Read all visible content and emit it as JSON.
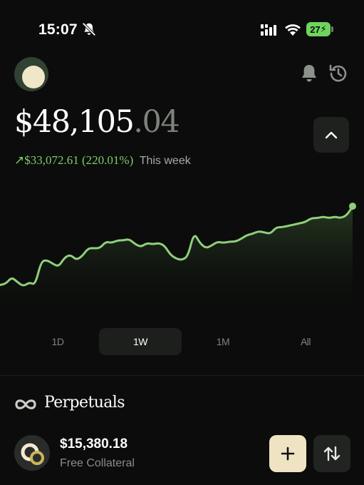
{
  "status_bar": {
    "time": "15:07",
    "battery": "27",
    "icons": [
      "bell-off-icon",
      "signal-icon",
      "wifi-icon",
      "battery-icon"
    ]
  },
  "header": {
    "icons": [
      "avatar",
      "bell-icon",
      "history-icon"
    ]
  },
  "balance": {
    "dollars": "$48,105",
    "cents": ".04"
  },
  "change": {
    "arrow": "↗",
    "amount": "$33,072.61 (220.01%)",
    "period": "This week"
  },
  "chart_data": {
    "type": "line",
    "x": [
      0,
      1,
      2,
      3,
      4,
      5,
      6,
      7,
      8,
      9,
      10,
      11,
      12,
      13,
      14,
      15,
      16,
      17,
      18,
      19,
      20,
      21,
      22,
      23,
      24,
      25,
      26,
      27,
      28,
      29,
      30,
      31,
      32,
      33,
      34,
      35,
      36,
      37,
      38,
      39,
      40,
      41,
      42,
      43,
      44,
      45,
      46,
      47,
      48,
      49,
      50,
      51,
      52,
      53,
      54,
      55,
      56,
      57,
      58,
      59,
      60
    ],
    "values": [
      22,
      23,
      28,
      24,
      21,
      24,
      22,
      40,
      41,
      38,
      36,
      43,
      45,
      41,
      44,
      50,
      50,
      50,
      55,
      54,
      56,
      56,
      57,
      53,
      51,
      54,
      53,
      54,
      52,
      45,
      42,
      41,
      44,
      62,
      54,
      50,
      52,
      55,
      54,
      55,
      55,
      57,
      60,
      61,
      63,
      62,
      61,
      66,
      66,
      67,
      68,
      69,
      70,
      73,
      73,
      74,
      73,
      74,
      73,
      75,
      82
    ],
    "ylim": [
      0,
      100
    ],
    "color": "#8fcf7c",
    "grid": false,
    "xlabel": "",
    "ylabel": ""
  },
  "range_tabs": [
    {
      "label": "1D",
      "active": false
    },
    {
      "label": "1W",
      "active": true
    },
    {
      "label": "1M",
      "active": false
    },
    {
      "label": "All",
      "active": false
    }
  ],
  "perpetuals": {
    "title": "Perpetuals",
    "icon": "infinity-icon",
    "collateral_amount": "$15,380.18",
    "collateral_label": "Free Collateral",
    "add_label": "+",
    "actions": [
      "plus-icon",
      "swap-arrows-icon"
    ]
  },
  "colors": {
    "background": "#0b0c0b",
    "accent_green": "#7ccf6a",
    "cream": "#efe3c3",
    "battery_green": "#6fd45c"
  }
}
